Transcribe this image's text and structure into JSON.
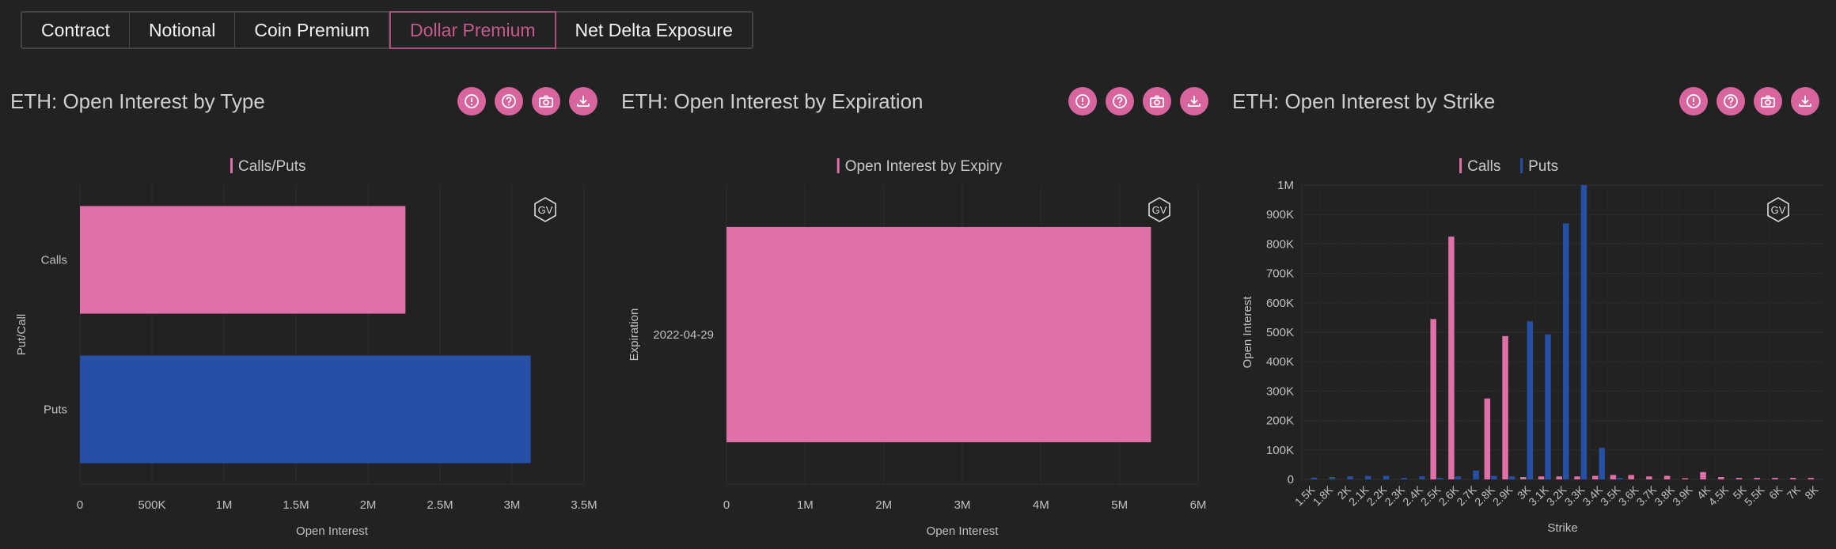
{
  "tabs": [
    {
      "label": "Contract",
      "active": false
    },
    {
      "label": "Notional",
      "active": false
    },
    {
      "label": "Coin Premium",
      "active": false
    },
    {
      "label": "Dollar Premium",
      "active": true
    },
    {
      "label": "Net Delta Exposure",
      "active": false
    }
  ],
  "colors": {
    "calls": "#e070a8",
    "puts": "#2650a6",
    "accent": "#d9659f",
    "background": "#222222"
  },
  "icons": [
    "info-icon",
    "help-icon",
    "camera-icon",
    "download-icon"
  ],
  "watermark": "GV",
  "panels": [
    {
      "title": "ETH: Open Interest by Type"
    },
    {
      "title": "ETH: Open Interest by Expiration"
    },
    {
      "title": "ETH: Open Interest by Strike"
    }
  ],
  "chart_data": [
    {
      "type": "bar",
      "orientation": "horizontal",
      "legend": [
        "Calls/Puts"
      ],
      "categories": [
        "Calls",
        "Puts"
      ],
      "values": [
        2260000,
        3130000
      ],
      "bar_colors": [
        "#e070a8",
        "#2650a6"
      ],
      "xlabel": "Open Interest",
      "ylabel": "Put/Call",
      "xlim": [
        0,
        3500000
      ],
      "xticks": [
        "0",
        "500K",
        "1M",
        "1.5M",
        "2M",
        "2.5M",
        "3M",
        "3.5M"
      ],
      "grid": true
    },
    {
      "type": "bar",
      "orientation": "horizontal",
      "legend": [
        "Open Interest by Expiry"
      ],
      "categories": [
        "2022-04-29"
      ],
      "values": [
        5400000
      ],
      "bar_colors": [
        "#e070a8"
      ],
      "xlabel": "Open Interest",
      "ylabel": "Expiration",
      "xlim": [
        0,
        6000000
      ],
      "xticks": [
        "0",
        "1M",
        "2M",
        "3M",
        "4M",
        "5M",
        "6M"
      ],
      "grid": true
    },
    {
      "type": "bar",
      "orientation": "vertical",
      "legend": [
        "Calls",
        "Puts"
      ],
      "categories": [
        "1.5K",
        "1.8K",
        "2K",
        "2.1K",
        "2.2K",
        "2.3K",
        "2.4K",
        "2.5K",
        "2.6K",
        "2.7K",
        "2.8K",
        "2.9K",
        "3K",
        "3.1K",
        "3.2K",
        "3.3K",
        "3.4K",
        "3.5K",
        "3.6K",
        "3.7K",
        "3.8K",
        "3.9K",
        "4K",
        "4.5K",
        "5K",
        "5.5K",
        "6K",
        "7K",
        "8K"
      ],
      "series": [
        {
          "name": "Calls",
          "values": [
            0,
            0,
            0,
            0,
            0,
            0,
            0,
            545000,
            825000,
            0,
            275000,
            487000,
            8000,
            10000,
            10000,
            10000,
            12000,
            15000,
            15000,
            10000,
            12000,
            4000,
            25000,
            8000,
            5000,
            5000,
            5000,
            5000,
            5000
          ]
        },
        {
          "name": "Puts",
          "values": [
            6000,
            8000,
            10000,
            12000,
            12000,
            5000,
            10000,
            5000,
            10000,
            30000,
            12000,
            10000,
            537000,
            493000,
            870000,
            1000000,
            107000,
            5000,
            0,
            0,
            0,
            0,
            0,
            0,
            0,
            0,
            0,
            0,
            0
          ]
        }
      ],
      "xlabel": "Strike",
      "ylabel": "Open Interest",
      "ylim": [
        0,
        1000000
      ],
      "yticks": [
        "0",
        "100K",
        "200K",
        "300K",
        "400K",
        "500K",
        "600K",
        "700K",
        "800K",
        "900K",
        "1M"
      ],
      "grid": true
    }
  ]
}
